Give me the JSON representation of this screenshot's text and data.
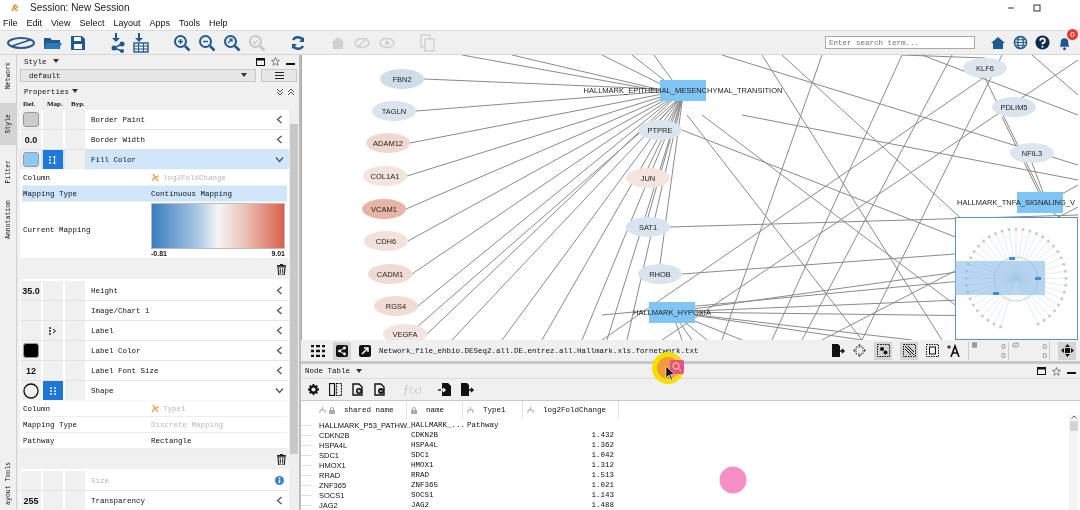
{
  "window": {
    "title": "Session: New Session"
  },
  "menu": [
    "File",
    "Edit",
    "View",
    "Select",
    "Layout",
    "Apps",
    "Tools",
    "Help"
  ],
  "toolbar": {
    "search": {
      "placeholder": "Enter search term..."
    },
    "notification_count": "0"
  },
  "side_tabs": [
    {
      "label": "Network",
      "selected": false
    },
    {
      "label": "Style",
      "selected": true
    },
    {
      "label": "Filter",
      "selected": false
    },
    {
      "label": "Annotation",
      "selected": false
    },
    {
      "label": "ayout Tools",
      "selected": false
    }
  ],
  "style_panel": {
    "title": "Style",
    "style": "default",
    "section": "Properties",
    "headers": [
      "Def.",
      "Map.",
      "Byp."
    ],
    "properties": [
      {
        "name": "Border Paint",
        "selected": false,
        "expanded": false,
        "disabled": false,
        "info": false,
        "default": {
          "kind": "swatch",
          "color": "#cccccc"
        }
      },
      {
        "name": "Border Width",
        "selected": false,
        "expanded": false,
        "disabled": false,
        "info": false,
        "default": {
          "kind": "text",
          "text": "0.0"
        }
      },
      {
        "name": "Fill Color",
        "selected": true,
        "expanded": true,
        "disabled": false,
        "info": false,
        "default": {
          "kind": "swatch",
          "color": "#8ccaf5"
        },
        "mapping": {
          "kind": "continuous"
        },
        "details": [
          {
            "label": "Column",
            "kind": "column",
            "value": "log2FoldChange",
            "selected": false,
            "disabled": true
          },
          {
            "label": "Mapping Type",
            "kind": "text",
            "value": "Continuous Mapping",
            "selected": true,
            "disabled": false
          },
          {
            "label": "Current Mapping",
            "kind": "gradient",
            "min": "-0.81",
            "max": "9.01",
            "selected": false,
            "disabled": false
          }
        ]
      },
      {
        "name": "Height",
        "selected": false,
        "expanded": false,
        "disabled": false,
        "info": false,
        "default": {
          "kind": "text",
          "text": "35.0"
        }
      },
      {
        "name": "Image/Chart 1",
        "selected": false,
        "expanded": false,
        "disabled": false,
        "info": false,
        "default": {
          "kind": "none"
        }
      },
      {
        "name": "Label",
        "selected": false,
        "expanded": false,
        "disabled": false,
        "info": false,
        "default": {
          "kind": "none"
        },
        "mapping": {
          "kind": "passthrough"
        }
      },
      {
        "name": "Label Color",
        "selected": false,
        "expanded": false,
        "disabled": false,
        "info": false,
        "default": {
          "kind": "swatch",
          "color": "#000000"
        }
      },
      {
        "name": "Label Font Size",
        "selected": false,
        "expanded": false,
        "disabled": false,
        "info": false,
        "default": {
          "kind": "text",
          "text": "12"
        }
      },
      {
        "name": "Shape",
        "selected": false,
        "expanded": true,
        "disabled": false,
        "info": false,
        "default": {
          "kind": "circle"
        },
        "mapping": {
          "kind": "discrete"
        },
        "details": [
          {
            "label": "Column",
            "kind": "column",
            "value": "Type1",
            "selected": false,
            "disabled": true
          },
          {
            "label": "Mapping Type",
            "kind": "text",
            "value": "Discrete Mapping",
            "selected": false,
            "disabled": true
          },
          {
            "label": "Pathway",
            "kind": "text",
            "value": "Rectangle",
            "selected": false,
            "disabled": false
          }
        ]
      },
      {
        "name": "Size",
        "selected": false,
        "expanded": false,
        "disabled": true,
        "info": true,
        "default": {
          "kind": "none"
        }
      },
      {
        "name": "Transparency",
        "selected": false,
        "expanded": false,
        "disabled": false,
        "info": false,
        "default": {
          "kind": "text",
          "text": "255"
        }
      }
    ]
  },
  "network": {
    "nodes": [
      {
        "label": "FBN2",
        "kind": "gene",
        "color": "#cfdde9"
      },
      {
        "label": "TAGLN",
        "kind": "gene",
        "color": "#d9e4ee"
      },
      {
        "label": "ADAM12",
        "kind": "gene",
        "color": "#f0d8d1"
      },
      {
        "label": "COL1A1",
        "kind": "gene",
        "color": "#f3e3df"
      },
      {
        "label": "VCAM1",
        "kind": "gene",
        "color": "#e6b5a6"
      },
      {
        "label": "CDH6",
        "kind": "gene",
        "color": "#f3e1dc"
      },
      {
        "label": "CADM1",
        "kind": "gene",
        "color": "#f1dad4"
      },
      {
        "label": "RGS4",
        "kind": "gene",
        "color": "#f1dbd5"
      },
      {
        "label": "VEGFA",
        "kind": "gene",
        "color": "#f4e4e0"
      },
      {
        "label": "HALLMARK_EPITHELIAL_MESENCHYMAL_TRANSITION",
        "kind": "pathway",
        "color": "#7fc5f5"
      },
      {
        "label": "PTPRE",
        "kind": "gene",
        "color": "#dbe5ee"
      },
      {
        "label": "JUN",
        "kind": "gene",
        "color": "#f3e4e0"
      },
      {
        "label": "SAT1",
        "kind": "gene",
        "color": "#d9e4ee"
      },
      {
        "label": "RHOB",
        "kind": "gene",
        "color": "#d9e4ee"
      },
      {
        "label": "HALLMARK_HYPOXIA",
        "kind": "pathway",
        "color": "#7fc5f5"
      },
      {
        "label": "KLF6",
        "kind": "gene",
        "color": "#dde6ef"
      },
      {
        "label": "PDLIM5",
        "kind": "gene",
        "color": "#d9e4ee"
      },
      {
        "label": "NFIL3",
        "kind": "gene",
        "color": "#dde6ef"
      },
      {
        "label": "HALLMARK_TNFA_SIGNALING_V",
        "kind": "pathway",
        "color": "#7fc5f5"
      }
    ],
    "file_name": "Network_file_ehbio.DESeq2.all.DE.entrez.all.Hallmark.xls.fornetwork.txt",
    "counts": [
      "0",
      "0",
      "0",
      "0"
    ]
  },
  "node_table": {
    "title": "Node Table",
    "columns": [
      {
        "label": "shared name",
        "shared": true,
        "locked": true
      },
      {
        "label": "name",
        "shared": false,
        "locked": true
      },
      {
        "label": "Type1",
        "shared": true,
        "locked": false
      },
      {
        "label": "log2FoldChange",
        "shared": true,
        "locked": false
      }
    ],
    "rows": [
      {
        "shared_name": "HALLMARK_P53_PATHW...",
        "name": "HALLMARK_...",
        "type1": "Pathway"
      },
      {
        "shared_name": "CDKN2B",
        "name": "CDKN2B",
        "log2FoldChange": "1.432"
      },
      {
        "shared_name": "HSPA4L",
        "name": "HSPA4L",
        "log2FoldChange": "1.362"
      },
      {
        "shared_name": "SDC1",
        "name": "SDC1",
        "log2FoldChange": "1.042"
      },
      {
        "shared_name": "HMOX1",
        "name": "HMOX1",
        "log2FoldChange": "1.312"
      },
      {
        "shared_name": "RRAD",
        "name": "RRAD",
        "log2FoldChange": "1.513"
      },
      {
        "shared_name": "ZNF365",
        "name": "ZNF365",
        "log2FoldChange": "1.021"
      },
      {
        "shared_name": "SOCS1",
        "name": "SOCS1",
        "log2FoldChange": "1.143"
      },
      {
        "shared_name": "JAG2",
        "name": "JAG2",
        "log2FoldChange": "1.488"
      }
    ]
  }
}
